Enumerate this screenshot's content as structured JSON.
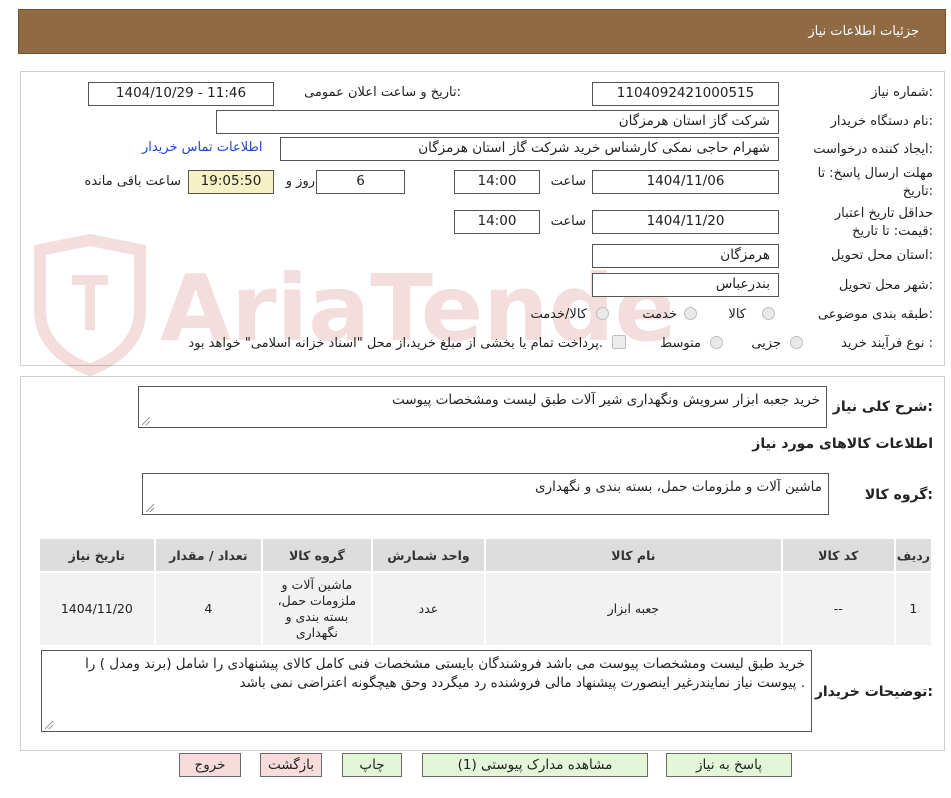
{
  "header": {
    "title": "جزئیات اطلاعات نیاز"
  },
  "info": {
    "need_number_label": "شماره نیاز:",
    "need_number": "1104092421000515",
    "announce_label": "تاریخ و ساعت اعلان عمومی:",
    "announce_value": "1404/10/29 - 11:46",
    "buyer_org_label": "نام دستگاه خریدار:",
    "buyer_org": "شرکت گاز استان هرمزگان",
    "requester_label": "ایجاد کننده درخواست:",
    "requester": "شهرام حاجی نمکی کارشناس خرید شرکت گاز استان هرمزگان",
    "contact_link": "اطلاعات تماس خریدار",
    "deadline_label_1": "مهلت ارسال پاسخ: تا",
    "deadline_label_2": "تاریخ:",
    "deadline_date": "1404/11/06",
    "time_label": "ساعت",
    "deadline_time": "14:00",
    "days_value": "6",
    "days_label": "روز و",
    "remaining_time": "19:05:50",
    "remaining_label": "ساعت باقی مانده",
    "validity_label_1": "حداقل تاریخ اعتبار",
    "validity_label_2": "قیمت: تا تاریخ:",
    "validity_date": "1404/11/20",
    "validity_time": "14:00",
    "province_label": "استان محل تحویل:",
    "province": "هرمزگان",
    "city_label": "شهر محل تحویل:",
    "city": "بندرعباس",
    "category_label": "طبقه بندی موضوعی:",
    "category_options": [
      "کالا",
      "خدمت",
      "کالا/خدمت"
    ],
    "process_label": "نوع فرآیند خرید :",
    "process_options": [
      "جزیی",
      "متوسط"
    ],
    "process_note": "پرداخت تمام یا بخشی از مبلغ خرید،از محل \"اسناد خزانه اسلامی\" خواهد بود."
  },
  "description": {
    "label": "شرح کلی نیاز:",
    "value": "خرید جعبه ابزار سرویش ونگهداری شیر آلات طبق لیست ومشخصات پیوست"
  },
  "goods": {
    "section_title": "اطلاعات کالاهای مورد نیاز",
    "group_label": "گروه کالا:",
    "group_value": "ماشین آلات و ملزومات حمل، بسته بندی و نگهداری",
    "columns": [
      "ردیف",
      "کد کالا",
      "نام کالا",
      "واحد شمارش",
      "گروه کالا",
      "تعداد / مقدار",
      "تاریخ نیاز"
    ],
    "rows": [
      {
        "index": "1",
        "code": "--",
        "name": "جعبه ابزار",
        "unit": "عدد",
        "group": "ماشین آلات و ملزومات حمل، بسته بندی و نگهداری",
        "qty": "4",
        "date": "1404/11/20"
      }
    ]
  },
  "buyer_notes": {
    "label": "توضیحات خریدار:",
    "value": "خرید طبق لیست ومشخصات پیوست می باشد فروشندگان بایستی مشخصات فنی کامل کالای پیشنهادی را شامل (برند ومدل ) را پیوست نیاز نمایندرغیر اینصورت پیشنهاد مالی فروشنده رد میگردد وحق هیچگونه اعتراضی نمی باشد ."
  },
  "buttons": {
    "reply": "پاسخ به نیاز",
    "attachments": "مشاهده مدارک پیوستی (1)",
    "print": "چاپ",
    "back": "بازگشت",
    "exit": "خروج"
  },
  "watermark": {
    "text": "AriaTender.neT"
  },
  "colors": {
    "header_bg": "#8f6a42",
    "link": "#2148c9",
    "remaining_bg": "#f6f1c4",
    "button_green": "#e3f7d8",
    "button_pink": "#f8dcdc"
  }
}
